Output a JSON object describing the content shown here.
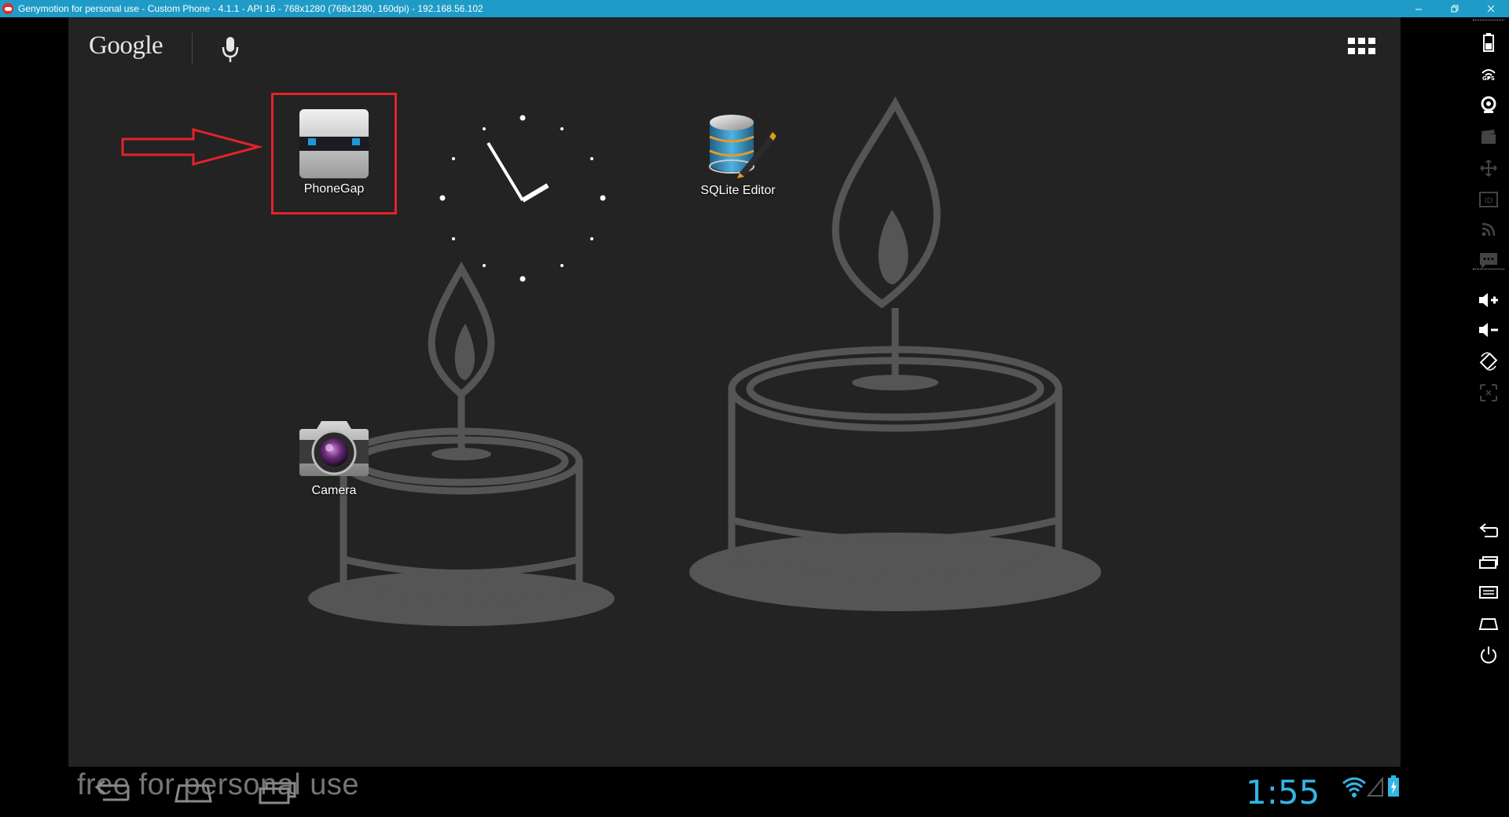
{
  "window": {
    "title": "Genymotion for personal use - Custom Phone - 4.1.1 - API 16 - 768x1280 (768x1280, 160dpi) - 192.168.56.102"
  },
  "home": {
    "search_logo": "Google",
    "apps": [
      {
        "label": "PhoneGap",
        "icon": "phonegap-icon"
      },
      {
        "label": "SQLite Editor",
        "icon": "sqlite-editor-icon"
      },
      {
        "label": "Camera",
        "icon": "camera-icon"
      }
    ],
    "annotation": {
      "highlight_color": "#e4222a",
      "points_to": "PhoneGap"
    }
  },
  "statusbar": {
    "time": "1:55",
    "watermark": "free for personal use",
    "accent_color": "#33b5e5"
  },
  "nav_buttons": [
    "back-icon",
    "home-icon",
    "recent-apps-icon"
  ],
  "toolbar": {
    "items": [
      "battery-icon",
      "gps-icon",
      "webcam-icon",
      "screencast-icon",
      "move-icon",
      "id-icon",
      "rss-icon",
      "sms-icon",
      "volume-up-icon",
      "volume-down-icon",
      "rotate-icon",
      "scale-icon",
      "back-icon",
      "recent-icon",
      "menu-icon",
      "home-icon",
      "power-icon"
    ],
    "gps_label": "GPS",
    "id_label": "ID"
  },
  "colors": {
    "titlebar": "#1e9bc6",
    "screen_bg": "#232323",
    "wallpaper_stroke": "#555555"
  }
}
